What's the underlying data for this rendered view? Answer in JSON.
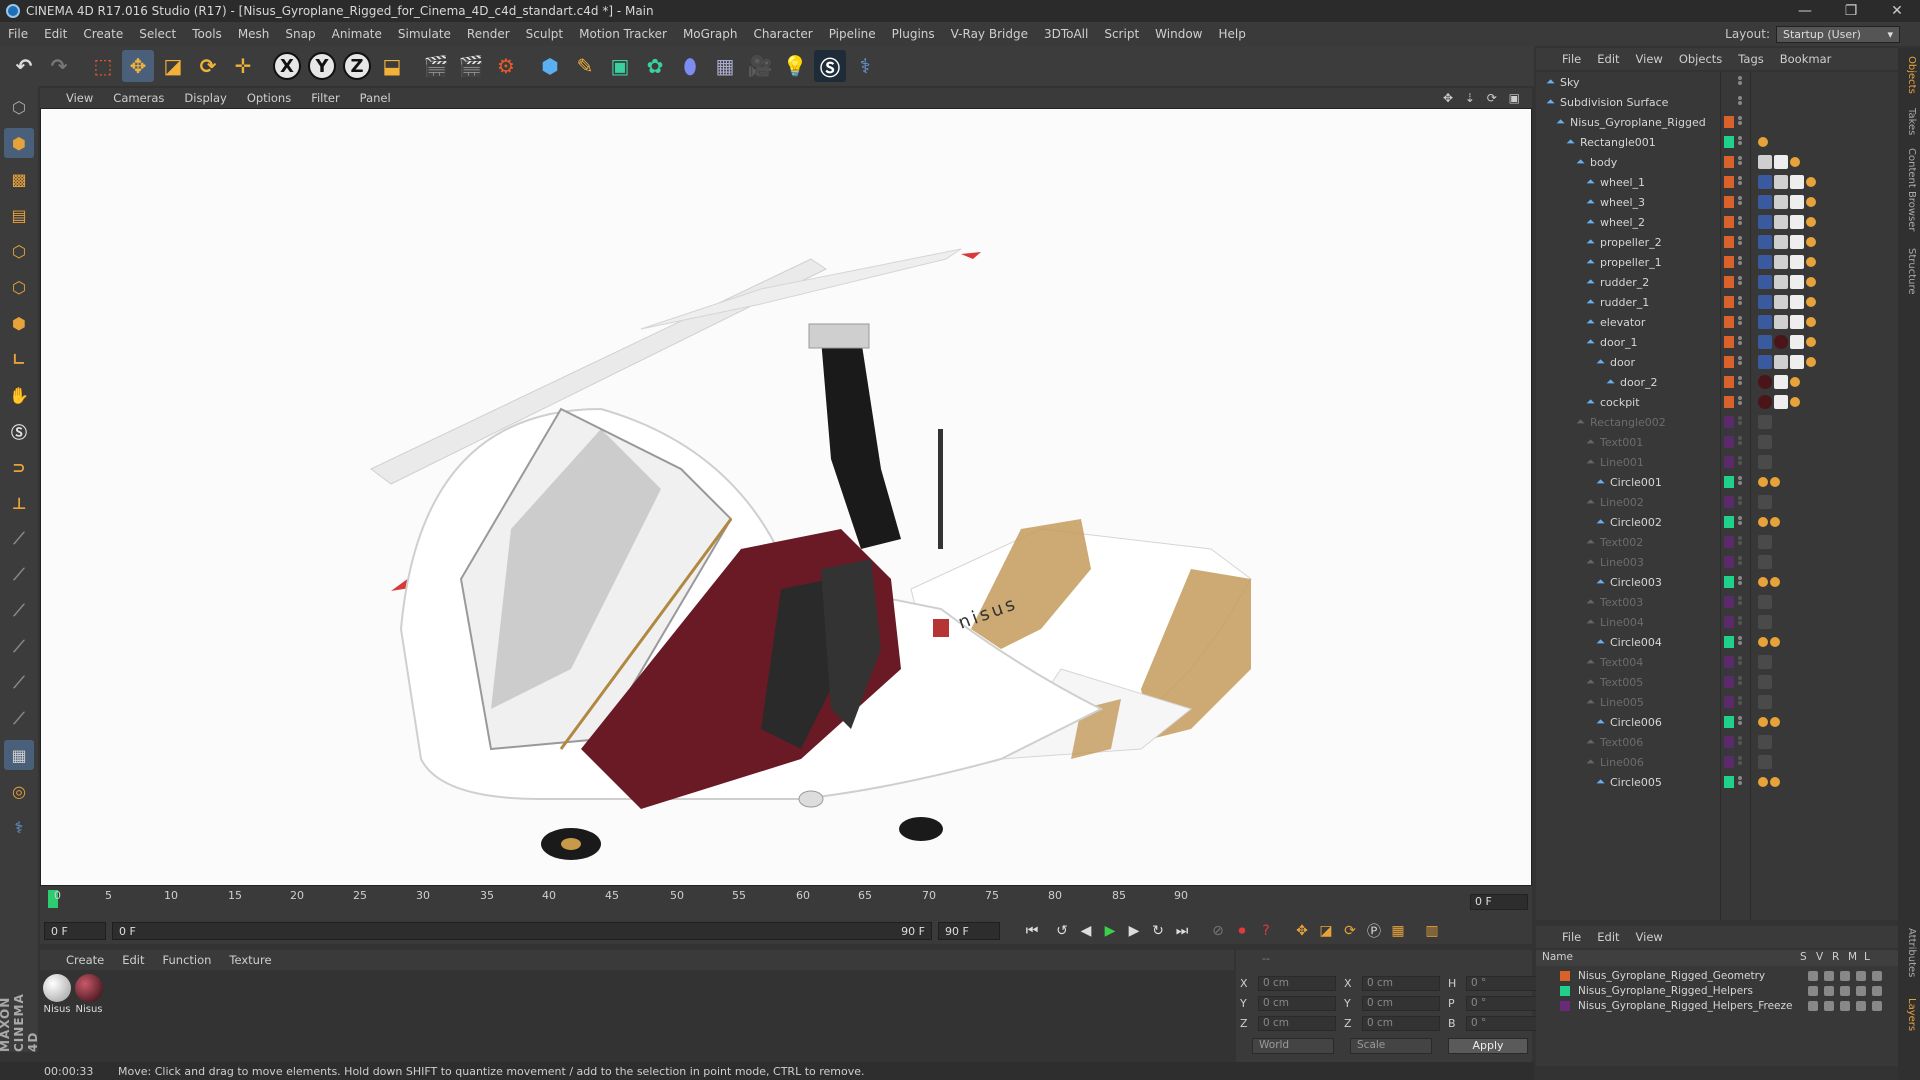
{
  "window": {
    "title": "CINEMA 4D R17.016 Studio (R17) - [Nisus_Gyroplane_Rigged_for_Cinema_4D_c4d_standart.c4d *] - Main",
    "controls": [
      "—",
      "❐",
      "✕"
    ]
  },
  "menubar": {
    "items": [
      "File",
      "Edit",
      "Create",
      "Select",
      "Tools",
      "Mesh",
      "Snap",
      "Animate",
      "Simulate",
      "Render",
      "Sculpt",
      "Motion Tracker",
      "MoGraph",
      "Character",
      "Pipeline",
      "Plugins",
      "V-Ray Bridge",
      "3DToAll",
      "Script",
      "Window",
      "Help"
    ],
    "layout_label": "Layout:",
    "layout_value": "Startup (User)"
  },
  "toolbar": {
    "axis": [
      "X",
      "Y",
      "Z"
    ],
    "icons": [
      "undo-icon",
      "redo-icon",
      "live-selection-icon",
      "move-icon",
      "scale-icon",
      "rotate-icon",
      "add-icon",
      "x-axis-icon",
      "y-axis-icon",
      "z-axis-icon",
      "coordinate-system-icon",
      "render-view-icon",
      "render-picture-viewer-icon",
      "edit-render-settings-icon",
      "cube-icon",
      "pen-icon",
      "subdivision-icon",
      "mograph-cloner-icon",
      "deformer-icon",
      "floor-icon",
      "camera-icon",
      "light-icon",
      "vray-icon",
      "python-icon"
    ]
  },
  "viewport": {
    "menu": [
      "View",
      "Cameras",
      "Display",
      "Options",
      "Filter",
      "Panel"
    ],
    "nav_icons": "✥ ⇣ ⟳ ▣",
    "model_brand": "nisus"
  },
  "timeline": {
    "ticks": [
      "0",
      "5",
      "10",
      "15",
      "20",
      "25",
      "30",
      "35",
      "40",
      "45",
      "50",
      "55",
      "60",
      "65",
      "70",
      "75",
      "80",
      "85",
      "90"
    ],
    "current_frame": "0 F"
  },
  "transport": {
    "start": "0 F",
    "slider_start": "0 F",
    "slider_end": "90 F",
    "end": "90 F"
  },
  "material_manager": {
    "menu": [
      "Create",
      "Edit",
      "Function",
      "Texture"
    ],
    "materials": [
      {
        "label": "Nisus",
        "color": "#d8d8d8"
      },
      {
        "label": "Nisus",
        "color": "#4a1418"
      }
    ]
  },
  "coordinates": {
    "header": "--",
    "rows": [
      {
        "a": "X",
        "av": "0 cm",
        "b": "X",
        "bv": "0 cm",
        "c": "H",
        "cv": "0 °"
      },
      {
        "a": "Y",
        "av": "0 cm",
        "b": "Y",
        "bv": "0 cm",
        "c": "P",
        "cv": "0 °"
      },
      {
        "a": "Z",
        "av": "0 cm",
        "b": "Z",
        "bv": "0 cm",
        "c": "B",
        "cv": "0 °"
      }
    ],
    "mode": "World",
    "type": "Scale",
    "apply": "Apply"
  },
  "statusbar": {
    "time": "00:00:33",
    "message": "Move: Click and drag to move elements. Hold down SHIFT to quantize movement / add to the selection in point mode, CTRL to remove."
  },
  "object_manager": {
    "menu": [
      "File",
      "Edit",
      "View",
      "Objects",
      "Tags",
      "Bookmar"
    ],
    "rows": [
      {
        "name": "Sky",
        "indent": 0,
        "active": true,
        "color": "",
        "tags": []
      },
      {
        "name": "Subdivision Surface",
        "indent": 0,
        "active": true,
        "color": "",
        "tags": []
      },
      {
        "name": "Nisus_Gyroplane_Rigged",
        "indent": 1,
        "active": true,
        "color": "#d9622b",
        "tags": []
      },
      {
        "name": "Rectangle001",
        "indent": 2,
        "active": true,
        "color": "#1fd18a",
        "tags": [
          "xp"
        ]
      },
      {
        "name": "body",
        "indent": 3,
        "active": true,
        "color": "#d9622b",
        "tags": [
          "tex",
          "chk",
          "xp"
        ]
      },
      {
        "name": "wheel_1",
        "indent": 4,
        "active": true,
        "color": "#d9622b",
        "tags": [
          "uv",
          "tex",
          "chk",
          "xp"
        ]
      },
      {
        "name": "wheel_3",
        "indent": 4,
        "active": true,
        "color": "#d9622b",
        "tags": [
          "uv",
          "tex",
          "chk",
          "xp"
        ]
      },
      {
        "name": "wheel_2",
        "indent": 4,
        "active": true,
        "color": "#d9622b",
        "tags": [
          "uv",
          "tex",
          "chk",
          "xp"
        ]
      },
      {
        "name": "propeller_2",
        "indent": 4,
        "active": true,
        "color": "#d9622b",
        "tags": [
          "uv",
          "tex",
          "chk",
          "xp"
        ]
      },
      {
        "name": "propeller_1",
        "indent": 4,
        "active": true,
        "color": "#d9622b",
        "tags": [
          "uv",
          "tex",
          "chk",
          "xp"
        ]
      },
      {
        "name": "rudder_2",
        "indent": 4,
        "active": true,
        "color": "#d9622b",
        "tags": [
          "uv",
          "tex",
          "chk",
          "xp"
        ]
      },
      {
        "name": "rudder_1",
        "indent": 4,
        "active": true,
        "color": "#d9622b",
        "tags": [
          "uv",
          "tex",
          "chk",
          "xp"
        ]
      },
      {
        "name": "elevator",
        "indent": 4,
        "active": true,
        "color": "#d9622b",
        "tags": [
          "uv",
          "tex",
          "chk",
          "xp"
        ]
      },
      {
        "name": "door_1",
        "indent": 4,
        "active": true,
        "color": "#d9622b",
        "tags": [
          "uv",
          "mat",
          "chk",
          "xp"
        ]
      },
      {
        "name": "door",
        "indent": 5,
        "active": true,
        "color": "#d9622b",
        "tags": [
          "uv",
          "tex",
          "chk",
          "xp"
        ]
      },
      {
        "name": "door_2",
        "indent": 6,
        "active": true,
        "color": "#d9622b",
        "tags": [
          "mat",
          "chk",
          "xp"
        ]
      },
      {
        "name": "cockpit",
        "indent": 4,
        "active": true,
        "color": "#d9622b",
        "tags": [
          "mat",
          "chk",
          "xp"
        ]
      },
      {
        "name": "Rectangle002",
        "indent": 3,
        "active": false,
        "color": "#5a2a6a",
        "tags": [
          "dim"
        ]
      },
      {
        "name": "Text001",
        "indent": 4,
        "active": false,
        "color": "#5a2a6a",
        "tags": [
          "dim"
        ]
      },
      {
        "name": "Line001",
        "indent": 4,
        "active": false,
        "color": "#5a2a6a",
        "tags": [
          "dim"
        ]
      },
      {
        "name": "Circle001",
        "indent": 5,
        "active": true,
        "color": "#1fd18a",
        "tags": [
          "no",
          "xp"
        ]
      },
      {
        "name": "Line002",
        "indent": 4,
        "active": false,
        "color": "#5a2a6a",
        "tags": [
          "dim"
        ]
      },
      {
        "name": "Circle002",
        "indent": 5,
        "active": true,
        "color": "#1fd18a",
        "tags": [
          "no",
          "xp"
        ]
      },
      {
        "name": "Text002",
        "indent": 4,
        "active": false,
        "color": "#5a2a6a",
        "tags": [
          "dim"
        ]
      },
      {
        "name": "Line003",
        "indent": 4,
        "active": false,
        "color": "#5a2a6a",
        "tags": [
          "dim"
        ]
      },
      {
        "name": "Circle003",
        "indent": 5,
        "active": true,
        "color": "#1fd18a",
        "tags": [
          "no",
          "xp"
        ]
      },
      {
        "name": "Text003",
        "indent": 4,
        "active": false,
        "color": "#5a2a6a",
        "tags": [
          "dim"
        ]
      },
      {
        "name": "Line004",
        "indent": 4,
        "active": false,
        "color": "#5a2a6a",
        "tags": [
          "dim"
        ]
      },
      {
        "name": "Circle004",
        "indent": 5,
        "active": true,
        "color": "#1fd18a",
        "tags": [
          "no",
          "xp"
        ]
      },
      {
        "name": "Text004",
        "indent": 4,
        "active": false,
        "color": "#5a2a6a",
        "tags": [
          "dim"
        ]
      },
      {
        "name": "Text005",
        "indent": 4,
        "active": false,
        "color": "#5a2a6a",
        "tags": [
          "dim"
        ]
      },
      {
        "name": "Line005",
        "indent": 4,
        "active": false,
        "color": "#5a2a6a",
        "tags": [
          "dim"
        ]
      },
      {
        "name": "Circle006",
        "indent": 5,
        "active": true,
        "color": "#1fd18a",
        "tags": [
          "no",
          "xp"
        ]
      },
      {
        "name": "Text006",
        "indent": 4,
        "active": false,
        "color": "#5a2a6a",
        "tags": [
          "dim"
        ]
      },
      {
        "name": "Line006",
        "indent": 4,
        "active": false,
        "color": "#5a2a6a",
        "tags": [
          "dim"
        ]
      },
      {
        "name": "Circle005",
        "indent": 5,
        "active": true,
        "color": "#1fd18a",
        "tags": [
          "no",
          "xp"
        ]
      }
    ]
  },
  "layer_manager": {
    "menu": [
      "File",
      "Edit",
      "View"
    ],
    "columns": [
      "Name",
      "S",
      "V",
      "R",
      "M",
      "L"
    ],
    "layers": [
      {
        "name": "Nisus_Gyroplane_Rigged_Geometry",
        "color": "#d9622b"
      },
      {
        "name": "Nisus_Gyroplane_Rigged_Helpers",
        "color": "#1fd18a"
      },
      {
        "name": "Nisus_Gyroplane_Rigged_Helpers_Freeze",
        "color": "#6a2a7a"
      }
    ]
  },
  "side_tabs": [
    "Objects",
    "Takes",
    "Content Browser",
    "Structure",
    "Attributes",
    "Layers"
  ],
  "maxon_logo": "MAXON CINEMA 4D"
}
